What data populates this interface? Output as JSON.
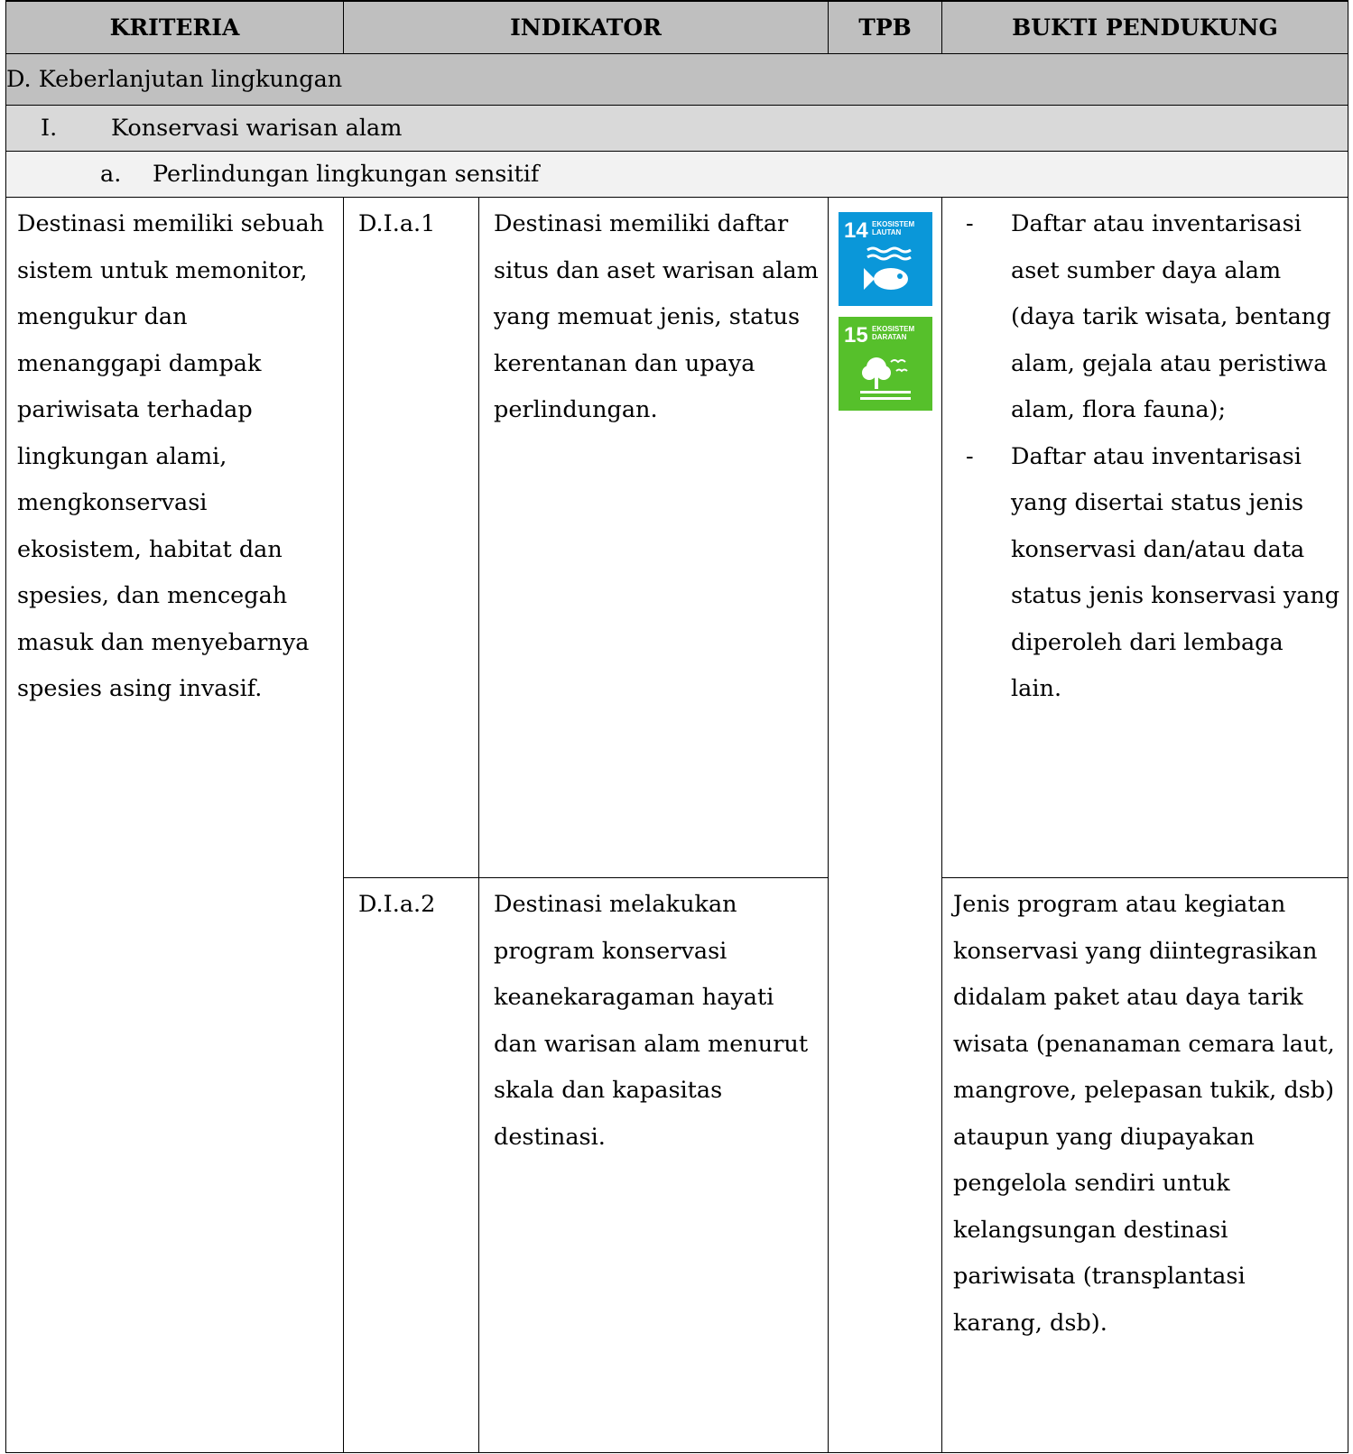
{
  "header": {
    "kriteria": "KRITERIA",
    "indikator": "INDIKATOR",
    "tpb": "TPB",
    "bukti": "BUKTI PENDUKUNG"
  },
  "section": {
    "label": "D. Keberlanjutan lingkungan",
    "sub": {
      "roman": "I.",
      "label": "Konservasi warisan alam"
    },
    "subsub": {
      "letter": "a.",
      "label": "Perlindungan lingkungan sensitif"
    }
  },
  "kriteria_text": "Destinasi memiliki sebuah sistem untuk memonitor, mengukur dan menanggapi dampak pariwisata terhadap lingkungan alami, mengkonservasi ekosistem, habitat dan spesies, dan mencegah masuk dan menyebarnya spesies asing invasif.",
  "indicators": [
    {
      "code": "D.I.a.1",
      "text": "Destinasi memiliki daftar situs dan aset warisan alam yang memuat jenis, status kerentanan dan upaya perlindungan."
    },
    {
      "code": "D.I.a.2",
      "text": "Destinasi melakukan program konservasi keanekaragaman hayati dan warisan alam menurut skala dan kapasitas destinasi."
    }
  ],
  "tpb_icons": [
    {
      "icon": "sdg-14-life-below-water-icon",
      "number": "14",
      "line1": "EKOSISTEM",
      "line2": "LAUTAN",
      "color": "#0a97d9"
    },
    {
      "icon": "sdg-15-life-on-land-icon",
      "number": "15",
      "line1": "EKOSISTEM",
      "line2": "DARATAN",
      "color": "#56c02b"
    }
  ],
  "evidence_1": {
    "bullet": "-",
    "items": [
      "Daftar atau inventarisasi aset sumber daya alam (daya tarik wisata, bentang alam, gejala atau peristiwa alam, flora fauna);",
      "Daftar atau inventarisasi yang disertai status jenis konservasi dan/atau data status jenis konservasi yang diperoleh dari lembaga lain."
    ]
  },
  "evidence_2": "Jenis program atau kegiatan konservasi yang diintegrasikan didalam paket atau daya tarik wisata (penanaman cemara laut, mangrove, pelepasan tukik, dsb) ataupun yang diupayakan pengelola sendiri untuk kelangsungan destinasi pariwisata (transplantasi karang, dsb)."
}
